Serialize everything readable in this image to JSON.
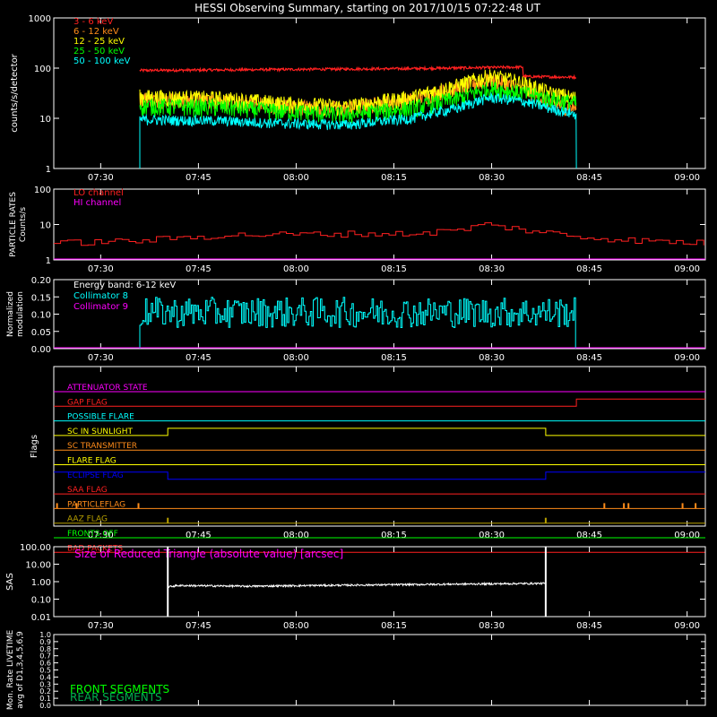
{
  "title": "HESSI Observing Summary, starting on 2017/10/15 07:22:48 UT",
  "x_tick_labels": [
    "07:30",
    "07:45",
    "08:00",
    "08:15",
    "08:30",
    "08:45",
    "09:00"
  ],
  "colors": {
    "bg": "#000000",
    "axes": "#ffffff",
    "red": "#ff2020",
    "orange": "#ff8c1a",
    "yellow": "#ffff00",
    "green": "#00ff00",
    "cyan": "#00ffff",
    "magenta": "#ff00ff",
    "blue": "#0000ff",
    "olive": "#b8a000",
    "white": "#ffffff",
    "darkgreen": "#00b050"
  },
  "chart_data": [
    {
      "id": "count_rates",
      "type": "line",
      "ylabel": "counts/s/detector",
      "yscale": "log",
      "ylim": [
        1,
        1000
      ],
      "y_tick_labels": [
        "1",
        "10",
        "100",
        "1000"
      ],
      "x_range_minutes": [
        0,
        100
      ],
      "data_window_minutes": [
        13.2,
        80.2
      ],
      "legend_position": "top-left",
      "series": [
        {
          "name": "3 - 6 keV",
          "color": "red",
          "x": [
            13.2,
            25,
            40,
            55,
            65,
            72,
            72.01,
            80.2
          ],
          "y": [
            90,
            92,
            95,
            98,
            102,
            105,
            68,
            66
          ],
          "noise": 0.03
        },
        {
          "name": "6 - 12 keV",
          "color": "orange",
          "x": [
            13.2,
            25,
            35,
            45,
            55,
            62,
            67,
            72,
            76,
            80.2
          ],
          "y": [
            25,
            23,
            18,
            16,
            24,
            40,
            60,
            38,
            20,
            16
          ],
          "noise": 0.18
        },
        {
          "name": "12 - 25 keV",
          "color": "yellow",
          "x": [
            13.2,
            25,
            35,
            45,
            55,
            62,
            67,
            72,
            76,
            80.2
          ],
          "y": [
            27,
            25,
            20,
            17,
            26,
            45,
            70,
            50,
            32,
            25
          ],
          "noise": 0.2
        },
        {
          "name": "25 - 50 keV",
          "color": "green",
          "x": [
            13.2,
            25,
            35,
            45,
            55,
            62,
            67,
            72,
            76,
            80.2
          ],
          "y": [
            18,
            17,
            14,
            12,
            16,
            25,
            40,
            32,
            25,
            20
          ],
          "noise": 0.2
        },
        {
          "name": "50 - 100 keV",
          "color": "cyan",
          "x": [
            13.2,
            25,
            35,
            45,
            55,
            62,
            67,
            72,
            76,
            80.2
          ],
          "y": [
            9.5,
            9,
            8,
            7.5,
            10,
            16,
            26,
            22,
            16,
            12
          ],
          "noise": 0.12
        }
      ]
    },
    {
      "id": "particle_rates",
      "type": "line",
      "ylabel_lines": [
        "PARTICLE RATES",
        "Counts/s"
      ],
      "yscale": "log",
      "ylim": [
        1,
        100
      ],
      "y_tick_labels": [
        "1",
        "10",
        "100"
      ],
      "legend_position": "top-left",
      "series": [
        {
          "name": "LO channel",
          "color": "red",
          "x": [
            0,
            13,
            26,
            45,
            55,
            62,
            66,
            72,
            80,
            90,
            100
          ],
          "y": [
            3,
            3.5,
            5,
            5.5,
            5.5,
            7,
            10,
            7,
            4.5,
            3.5,
            3
          ],
          "step": true,
          "noise": 0.1
        },
        {
          "name": "HI channel",
          "color": "magenta",
          "x": [
            0,
            100
          ],
          "y": [
            1,
            1
          ]
        }
      ]
    },
    {
      "id": "modulation",
      "type": "line",
      "ylabel_lines": [
        "Normalized",
        "modulation"
      ],
      "ylim": [
        0,
        0.2
      ],
      "y_tick_labels": [
        "0.00",
        "0.05",
        "0.10",
        "0.15",
        "0.20"
      ],
      "annotation": "Energy band: 6-12 keV",
      "legend_position": "top-left",
      "series": [
        {
          "name": "Collimator 8",
          "color": "cyan",
          "x": [
            13.2,
            80.2
          ],
          "y": [
            0.105,
            0.105
          ],
          "noise_abs": 0.02
        },
        {
          "name": "Collimator 9",
          "color": "magenta",
          "x": [
            0,
            100
          ],
          "y": [
            0,
            0
          ]
        }
      ]
    },
    {
      "id": "flags",
      "type": "line",
      "ylabel": "Flags",
      "flags": [
        {
          "name": "ATTENUATOR STATE",
          "color": "magenta",
          "x": [
            0,
            100
          ],
          "y": [
            0,
            0
          ]
        },
        {
          "name": "GAP FLAG",
          "color": "red",
          "x": [
            0,
            80.2,
            80.2,
            100
          ],
          "y": [
            0,
            0,
            1,
            1
          ]
        },
        {
          "name": "POSSIBLE FLARE",
          "color": "cyan",
          "x": [
            0,
            100
          ],
          "y": [
            0,
            0
          ]
        },
        {
          "name": "SC IN SUNLIGHT",
          "color": "yellow",
          "x": [
            0,
            17.5,
            17.5,
            75.5,
            75.5,
            100
          ],
          "y": [
            0,
            0,
            1,
            1,
            0,
            0
          ]
        },
        {
          "name": "SC TRANSMITTER",
          "color": "orange",
          "x": [
            0,
            100
          ],
          "y": [
            0,
            0
          ]
        },
        {
          "name": "FLARE FLAG",
          "color": "yellow",
          "x": [
            0,
            100
          ],
          "y": [
            0,
            0
          ]
        },
        {
          "name": "ECLIPSE FLAG",
          "color": "blue",
          "x": [
            0,
            17.5,
            17.5,
            75.5,
            75.5,
            100
          ],
          "y": [
            1,
            1,
            0,
            0,
            1,
            1
          ]
        },
        {
          "name": "SAA FLAG",
          "color": "red",
          "x": [
            0,
            100
          ],
          "y": [
            0,
            0
          ]
        },
        {
          "name": "PARTICLEFLAG",
          "color": "orange",
          "x": [
            0,
            100
          ],
          "y": [
            0,
            0
          ],
          "spikes": [
            0.5,
            3.5,
            13,
            84.5,
            87.5,
            88.2,
            96.5,
            98.5
          ]
        },
        {
          "name": "AAZ FLAG",
          "color": "olive",
          "x": [
            0,
            100
          ],
          "y": [
            0,
            0
          ],
          "spikes": [
            17.5,
            75.5
          ]
        },
        {
          "name": "FRONTS OFF",
          "color": "green",
          "x": [
            0,
            100
          ],
          "y": [
            0,
            0
          ]
        },
        {
          "name": "BAD PACKETS",
          "color": "red",
          "x": [
            0,
            100
          ],
          "y": [
            0,
            0
          ]
        }
      ]
    },
    {
      "id": "sas",
      "type": "line",
      "ylabel": "SAS",
      "yscale": "log",
      "ylim": [
        0.01,
        100
      ],
      "y_tick_labels": [
        "0.01",
        "0.10",
        "1.00",
        "10.00",
        "100.00"
      ],
      "annotation": "Size of Reduced Triangle (absolute value) [arcsec]",
      "series": [
        {
          "name": "",
          "color": "white",
          "x": [
            17.5,
            19,
            30,
            75.5
          ],
          "y": [
            0.5,
            0.6,
            0.55,
            0.8
          ],
          "noise": 0.06,
          "edges": [
            17.5,
            75.5
          ],
          "edge_top": 100
        }
      ]
    },
    {
      "id": "livetime",
      "type": "line",
      "ylabel_lines": [
        "Mon. Rate LIVETIME",
        "avg of D1,3,4,5,6,9"
      ],
      "ylim": [
        0,
        1
      ],
      "y_tick_labels": [
        "0.0",
        "0.1",
        "0.2",
        "0.3",
        "0.4",
        "0.5",
        "0.6",
        "0.7",
        "0.8",
        "0.9",
        "1.0"
      ],
      "legend": [
        {
          "name": "FRONT SEGMENTS",
          "color": "green"
        },
        {
          "name": "REAR SEGMENTS",
          "color": "darkgreen"
        }
      ],
      "series": []
    }
  ]
}
